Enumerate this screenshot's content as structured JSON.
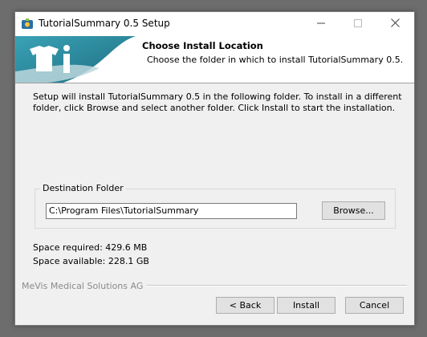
{
  "window": {
    "title": "TutorialSummary 0.5 Setup",
    "controls": {
      "minimize": "—",
      "maximize": "☐",
      "close": "✕"
    }
  },
  "header": {
    "title": "Choose Install Location",
    "subtitle": "Choose the folder in which to install TutorialSummary 0.5."
  },
  "intro": "Setup will install TutorialSummary 0.5 in the following folder. To install in a different folder, click Browse and select another folder. Click Install to start the installation.",
  "destination": {
    "label": "Destination Folder",
    "path": "C:\\Program Files\\TutorialSummary",
    "browse_label": "Browse..."
  },
  "space": {
    "required": "Space required: 429.6 MB",
    "available": "Space available: 228.1 GB"
  },
  "footer": {
    "brand": "MeVis Medical Solutions AG",
    "back_label": "< Back",
    "install_label": "Install",
    "cancel_label": "Cancel"
  },
  "colors": {
    "teal": "#2b8ea3",
    "dark_teal": "#1e6d80",
    "window_bg": "#f0f0f0"
  },
  "icons": [
    "app-icon",
    "minimize-icon",
    "maximize-icon",
    "close-icon",
    "logo-figure-icon"
  ]
}
